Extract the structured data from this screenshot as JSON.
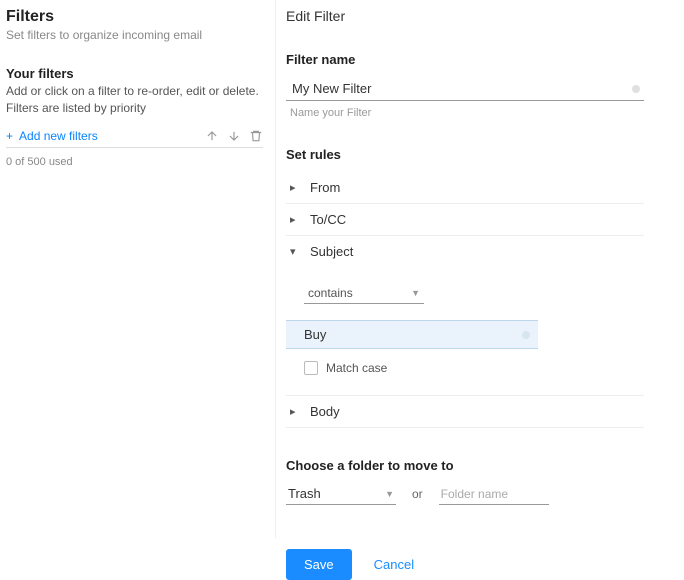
{
  "left": {
    "title": "Filters",
    "subtitle": "Set filters to organize incoming email",
    "your_filters_title": "Your filters",
    "your_filters_desc": "Add or click on a filter to re-order, edit or delete. Filters are listed by priority",
    "add_label": "Add new filters",
    "usage": "0 of 500 used"
  },
  "right": {
    "title": "Edit Filter",
    "filter_name_label": "Filter name",
    "filter_name_value": "My New Filter",
    "filter_name_helper": "Name your Filter",
    "set_rules_label": "Set rules",
    "rules": {
      "from": "From",
      "tocc": "To/CC",
      "subject": "Subject",
      "body": "Body"
    },
    "subject_condition": "contains",
    "subject_value": "Buy",
    "match_case_label": "Match case",
    "folder_label": "Choose a folder to move to",
    "folder_selected": "Trash",
    "or_label": "or",
    "folder_placeholder": "Folder name",
    "save_label": "Save",
    "cancel_label": "Cancel"
  }
}
